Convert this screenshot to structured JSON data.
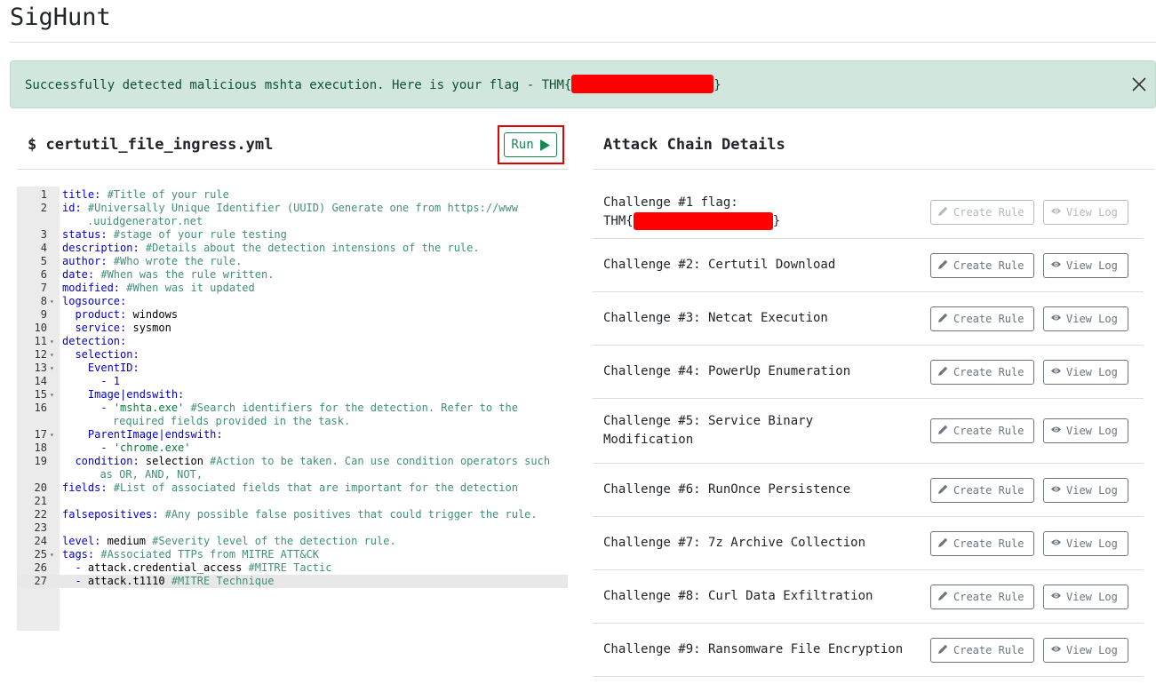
{
  "app": {
    "title": "SigHunt"
  },
  "alert": {
    "message": "Successfully detected malicious mshta execution. Here is your flag - THM{",
    "flag_close": "}"
  },
  "editor": {
    "filename": "$ certutil_file_ingress.yml",
    "run_label": "Run",
    "lines": [
      {
        "n": "1",
        "fold": "",
        "k": "title:",
        "v": "",
        "c": " #Title of your rule",
        "cont": ""
      },
      {
        "n": "2",
        "fold": "",
        "k": "id:",
        "v": "",
        "c": " #Universally Unique Identifier (UUID) Generate one from https://www",
        "cont": ".uuidgenerator.net"
      },
      {
        "n": "3",
        "fold": "",
        "k": "status:",
        "v": "",
        "c": " #stage of your rule testing",
        "cont": ""
      },
      {
        "n": "4",
        "fold": "",
        "k": "description:",
        "v": "",
        "c": " #Details about the detection intensions of the rule.",
        "cont": ""
      },
      {
        "n": "5",
        "fold": "",
        "k": "author:",
        "v": "",
        "c": " #Who wrote the rule.",
        "cont": ""
      },
      {
        "n": "6",
        "fold": "",
        "k": "date:",
        "v": "",
        "c": " #When was the rule written.",
        "cont": ""
      },
      {
        "n": "7",
        "fold": "",
        "k": "modified:",
        "v": "",
        "c": " #When was it updated",
        "cont": ""
      },
      {
        "n": "8",
        "fold": "▾",
        "k": "logsource:",
        "v": "",
        "c": "",
        "cont": ""
      },
      {
        "n": "9",
        "fold": "",
        "k": "  product:",
        "v": " windows",
        "c": "",
        "cont": ""
      },
      {
        "n": "10",
        "fold": "",
        "k": "  service:",
        "v": " sysmon",
        "c": "",
        "cont": ""
      },
      {
        "n": "11",
        "fold": "▾",
        "k": "detection:",
        "v": "",
        "c": "",
        "cont": ""
      },
      {
        "n": "12",
        "fold": "▾",
        "k": "  selection:",
        "v": "",
        "c": "",
        "cont": ""
      },
      {
        "n": "13",
        "fold": "▾",
        "k": "    EventID:",
        "v": "",
        "c": "",
        "cont": ""
      },
      {
        "n": "14",
        "fold": "",
        "k": "      - 1",
        "v": "",
        "c": "",
        "cont": ""
      },
      {
        "n": "15",
        "fold": "▾",
        "k": "    Image|endswith:",
        "v": "",
        "c": "",
        "cont": ""
      },
      {
        "n": "16",
        "fold": "",
        "k": "      - ",
        "v": "'mshta.exe'",
        "c": " #Search identifiers for the detection. Refer to the",
        "cont": "    required fields provided in the task."
      },
      {
        "n": "17",
        "fold": "▾",
        "k": "    ParentImage|endswith:",
        "v": "",
        "c": "",
        "cont": ""
      },
      {
        "n": "18",
        "fold": "",
        "k": "      - ",
        "v": "'chrome.exe'",
        "c": "",
        "cont": ""
      },
      {
        "n": "19",
        "fold": "",
        "k": "  condition:",
        "v": " selection",
        "c": " #Action to be taken. Can use condition operators such",
        "cont": "  as OR, AND, NOT,"
      },
      {
        "n": "20",
        "fold": "",
        "k": "fields:",
        "v": "",
        "c": " #List of associated fields that are important for the detection",
        "cont": ""
      },
      {
        "n": "21",
        "fold": "",
        "k": "",
        "v": "",
        "c": "",
        "cont": ""
      },
      {
        "n": "22",
        "fold": "",
        "k": "falsepositives:",
        "v": "",
        "c": " #Any possible false positives that could trigger the rule.",
        "cont": ""
      },
      {
        "n": "23",
        "fold": "",
        "k": "",
        "v": "",
        "c": "",
        "cont": ""
      },
      {
        "n": "24",
        "fold": "",
        "k": "level:",
        "v": " medium",
        "c": " #Severity level of the detection rule.",
        "cont": ""
      },
      {
        "n": "25",
        "fold": "▾",
        "k": "tags:",
        "v": "",
        "c": " #Associated TTPs from MITRE ATT&CK",
        "cont": ""
      },
      {
        "n": "26",
        "fold": "",
        "k": "  - ",
        "v": "attack.credential_access",
        "c": " #MITRE Tactic",
        "cont": ""
      },
      {
        "n": "27",
        "fold": "",
        "k": "  - ",
        "v": "attack.t1110",
        "c": " #MITRE Technique",
        "cont": ""
      }
    ]
  },
  "attack_chain": {
    "title": "Attack Chain Details",
    "create_label": "Create Rule",
    "view_label": "View Log",
    "challenges": [
      {
        "label": "Challenge #1 flag:",
        "label2": "THM{",
        "flag_close": "}",
        "disabled": true
      },
      {
        "label": "Challenge #2: Certutil Download",
        "label2": "",
        "disabled": false
      },
      {
        "label": "Challenge #3: Netcat Execution",
        "label2": "",
        "disabled": false
      },
      {
        "label": "Challenge #4: PowerUp Enumeration",
        "label2": "",
        "disabled": false
      },
      {
        "label": "Challenge #5: Service Binary",
        "label2": "Modification",
        "disabled": false
      },
      {
        "label": "Challenge #6: RunOnce Persistence",
        "label2": "",
        "disabled": false
      },
      {
        "label": "Challenge #7: 7z Archive Collection",
        "label2": "",
        "disabled": false
      },
      {
        "label": "Challenge #8: Curl Data Exfiltration",
        "label2": "",
        "disabled": false
      },
      {
        "label": "Challenge #9: Ransomware File Encryption",
        "label2": "",
        "disabled": false
      }
    ]
  }
}
